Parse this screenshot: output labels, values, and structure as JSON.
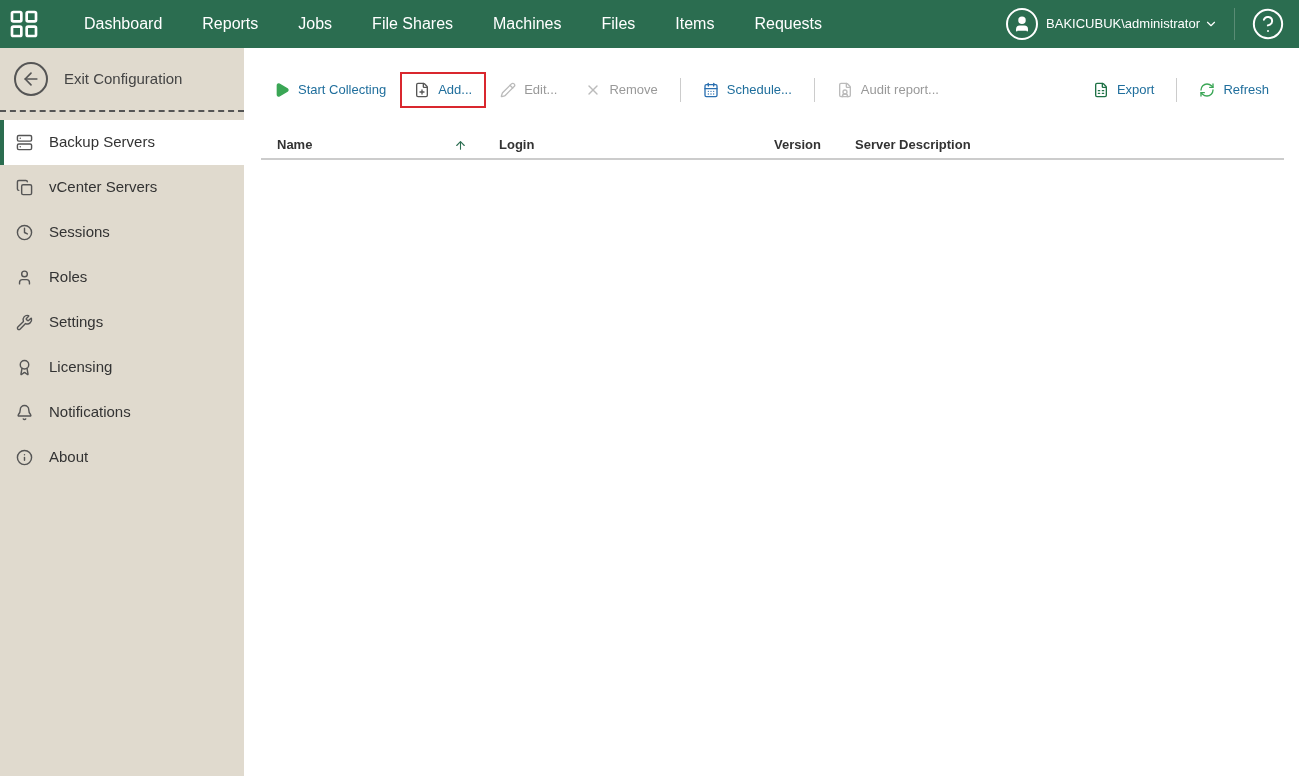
{
  "nav": {
    "items": [
      "Dashboard",
      "Reports",
      "Jobs",
      "File Shares",
      "Machines",
      "Files",
      "Items",
      "Requests"
    ],
    "user": "BAKICUBUK\\administrator"
  },
  "sidebar": {
    "exit": "Exit Configuration",
    "items": [
      {
        "label": "Backup Servers",
        "selected": true
      },
      {
        "label": "vCenter Servers",
        "selected": false
      },
      {
        "label": "Sessions",
        "selected": false
      },
      {
        "label": "Roles",
        "selected": false
      },
      {
        "label": "Settings",
        "selected": false
      },
      {
        "label": "Licensing",
        "selected": false
      },
      {
        "label": "Notifications",
        "selected": false
      },
      {
        "label": "About",
        "selected": false
      }
    ]
  },
  "toolbar": {
    "left": [
      [
        {
          "label": "Start Collecting",
          "disabled": false,
          "highlighted": false
        },
        {
          "label": "Add...",
          "disabled": false,
          "highlighted": true
        },
        {
          "label": "Edit...",
          "disabled": true,
          "highlighted": false
        },
        {
          "label": "Remove",
          "disabled": true,
          "highlighted": false
        }
      ],
      [
        {
          "label": "Schedule...",
          "disabled": false,
          "highlighted": false
        }
      ],
      [
        {
          "label": "Audit report...",
          "disabled": true,
          "highlighted": false
        }
      ]
    ],
    "right": [
      [
        {
          "label": "Export",
          "disabled": false,
          "highlighted": false
        }
      ],
      [
        {
          "label": "Refresh",
          "disabled": false,
          "highlighted": false
        }
      ]
    ]
  },
  "table": {
    "columns": [
      {
        "label": "Name",
        "sorted": true
      },
      {
        "label": "Login",
        "sorted": false
      },
      {
        "label": "Version",
        "sorted": false
      },
      {
        "label": "Server Description",
        "sorted": false
      }
    ]
  }
}
